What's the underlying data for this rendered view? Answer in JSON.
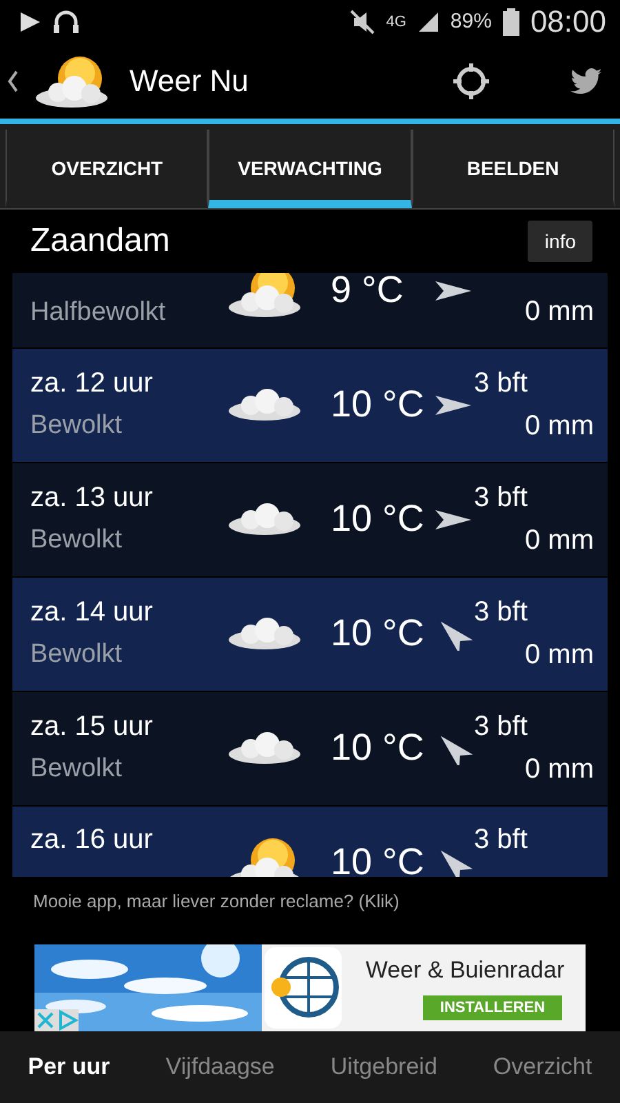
{
  "status_bar": {
    "battery": "89%",
    "time": "08:00",
    "network": "4G"
  },
  "app_bar": {
    "title": "Weer Nu"
  },
  "tabs": [
    {
      "label": "OVERZICHT",
      "selected": false
    },
    {
      "label": "VERWACHTING",
      "selected": true
    },
    {
      "label": "BEELDEN",
      "selected": false
    }
  ],
  "location": {
    "city": "Zaandam",
    "info_button": "info"
  },
  "forecast": [
    {
      "kind": "partlycloudy",
      "condition": "Halfbewolkt",
      "temperature": "9 °C",
      "wind_southeast": false,
      "rain": "0 mm"
    },
    {
      "kind": "cloudy",
      "time": "za. 12 uur",
      "condition": "Bewolkt",
      "temperature": "10 °C",
      "wind_southeast": false,
      "wind": "3 bft",
      "rain": "0 mm"
    },
    {
      "kind": "cloudy",
      "time": "za. 13 uur",
      "condition": "Bewolkt",
      "temperature": "10 °C",
      "wind_southeast": false,
      "wind": "3 bft",
      "rain": "0 mm"
    },
    {
      "kind": "cloudy",
      "time": "za. 14 uur",
      "condition": "Bewolkt",
      "temperature": "10 °C",
      "wind_southeast": true,
      "wind": "3 bft",
      "rain": "0 mm"
    },
    {
      "kind": "cloudy",
      "time": "za. 15 uur",
      "condition": "Bewolkt",
      "temperature": "10 °C",
      "wind_southeast": true,
      "wind": "3 bft",
      "rain": "0 mm"
    },
    {
      "kind": "partlycloudy",
      "time": "za. 16 uur",
      "temperature": "10 °C",
      "wind_southeast": true,
      "wind": "3 bft"
    }
  ],
  "ad_notice": "Mooie app, maar liever zonder reclame? (Klik)",
  "ad": {
    "title": "Weer & Buienradar",
    "button": "INSTALLEREN"
  },
  "bottom_nav": [
    {
      "label": "Per uur",
      "selected": true
    },
    {
      "label": "Vijfdaagse",
      "selected": false
    },
    {
      "label": "Uitgebreid",
      "selected": false
    },
    {
      "label": "Overzicht",
      "selected": false
    }
  ]
}
